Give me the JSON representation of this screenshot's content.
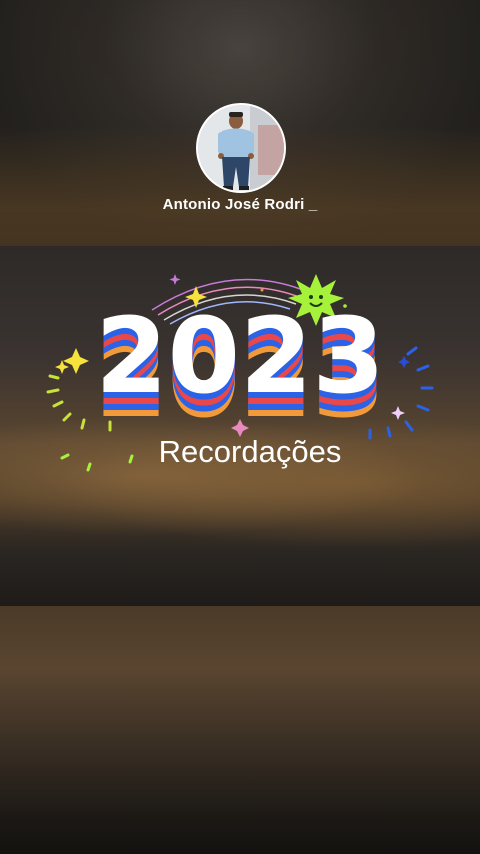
{
  "profile": {
    "username": "Antonio José Rodri _"
  },
  "recap": {
    "year": "2023",
    "subtitle": "Recordações"
  },
  "colors": {
    "accent_green": "#a6f23a",
    "stripe_red": "#e8484a",
    "stripe_blue": "#3a6ae8",
    "stripe_orange": "#f29a3a"
  }
}
